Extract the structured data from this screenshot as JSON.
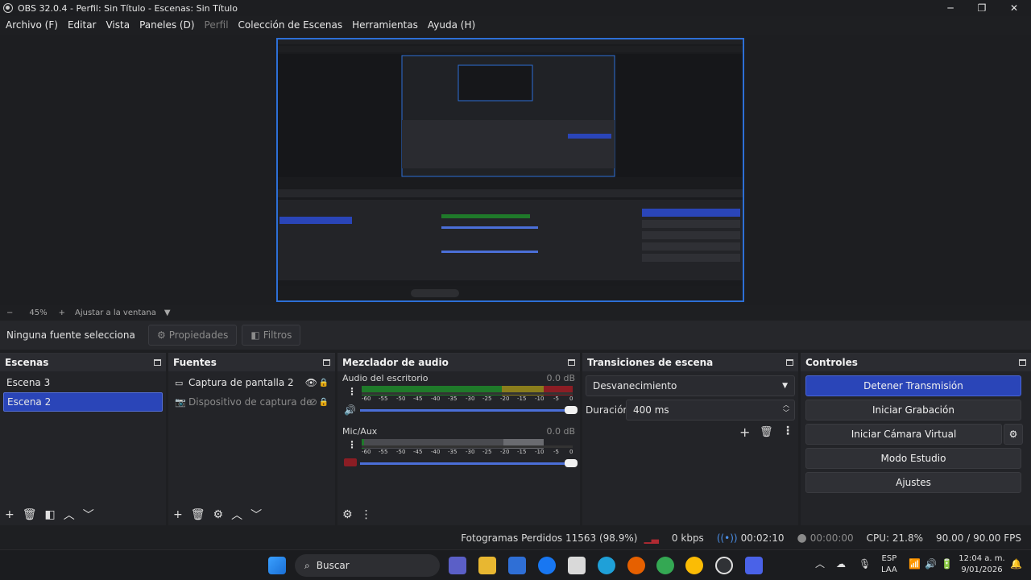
{
  "titlebar": {
    "title": "OBS 32.0.4 - Perfil: Sin Título - Escenas: Sin Título"
  },
  "menu": [
    {
      "label": "Archivo (F)",
      "disabled": false
    },
    {
      "label": "Editar",
      "disabled": false
    },
    {
      "label": "Vista",
      "disabled": false
    },
    {
      "label": "Paneles (D)",
      "disabled": false
    },
    {
      "label": "Perfil",
      "disabled": true
    },
    {
      "label": "Colección de Escenas",
      "disabled": false
    },
    {
      "label": "Herramientas",
      "disabled": false
    },
    {
      "label": "Ayuda (H)",
      "disabled": false
    }
  ],
  "zoom": {
    "minus": "−",
    "value": "45%",
    "plus": "+",
    "fit": "Ajustar a la ventana"
  },
  "sourcebar": {
    "no_selection": "Ninguna fuente selecciona",
    "properties": "Propiedades",
    "filters": "Filtros"
  },
  "scenes": {
    "title": "Escenas",
    "items": [
      "Escena 3",
      "Escena 2"
    ],
    "selected": "Escena 2"
  },
  "sources": {
    "title": "Fuentes",
    "items": [
      {
        "label": "Captura de pantalla 2",
        "icon": "monitor-icon",
        "visible": true
      },
      {
        "label": "Dispositivo de captura de",
        "icon": "camera-icon",
        "visible": false
      }
    ]
  },
  "mixer": {
    "title": "Mezclador de audio",
    "channels": [
      {
        "name": "Audio del escritorio",
        "db": "0.0 dB",
        "muted": false
      },
      {
        "name": "Mic/Aux",
        "db": "0.0 dB",
        "muted": true
      }
    ],
    "scale": [
      "-60",
      "-55",
      "-50",
      "-45",
      "-40",
      "-35",
      "-30",
      "-25",
      "-20",
      "-15",
      "-10",
      "-5",
      "0"
    ]
  },
  "transitions": {
    "title": "Transiciones de escena",
    "selected": "Desvanecimiento",
    "duration_label": "Duración",
    "duration_value": "400 ms"
  },
  "controls": {
    "title": "Controles",
    "stop_stream": "Detener Transmisión",
    "start_recording": "Iniciar Grabación",
    "virtual_cam": "Iniciar Cámara Virtual",
    "studio_mode": "Modo Estudio",
    "settings": "Ajustes"
  },
  "status": {
    "dropped": "Fotogramas Perdidos 11563 (98.9%)",
    "kbps": "0 kbps",
    "stream_time": "00:02:10",
    "rec_time": "00:00:00",
    "cpu": "CPU: 21.8%",
    "fps": "90.00 / 90.00 FPS"
  },
  "taskbar": {
    "search": "Buscar",
    "lang1": "ESP",
    "lang2": "LAA",
    "time": "12:04 a. m.",
    "date": "9/01/2026"
  },
  "colors": {
    "accent": "#2a45b8",
    "preview_border": "#2d6fd6",
    "meter_green": "#1f7a2a",
    "meter_yellow": "#8a7d1c",
    "meter_red": "#8b1d24"
  }
}
